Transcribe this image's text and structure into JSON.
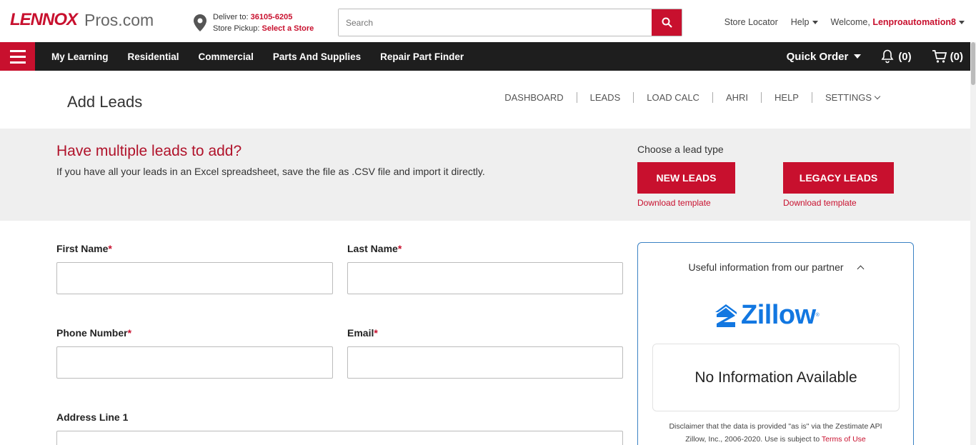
{
  "header": {
    "logo_brand": "LENNOX",
    "logo_site": "Pros.com",
    "deliver_label": "Deliver to:",
    "deliver_zip": "36105-6205",
    "pickup_label": "Store Pickup:",
    "pickup_link": "Select a Store",
    "search_placeholder": "Search",
    "store_locator": "Store Locator",
    "help": "Help",
    "welcome": "Welcome,",
    "username": "Lenproautomation8"
  },
  "nav": {
    "items": [
      "My Learning",
      "Residential",
      "Commercial",
      "Parts And Supplies",
      "Repair Part Finder"
    ],
    "quick_order": "Quick Order",
    "notifications": "(0)",
    "cart": "(0)"
  },
  "page": {
    "title": "Add Leads",
    "subnav": [
      "DASHBOARD",
      "LEADS",
      "LOAD CALC",
      "AHRI",
      "HELP",
      "SETTINGS"
    ]
  },
  "banner": {
    "heading": "Have multiple leads to add?",
    "text": "If you have all your leads in an Excel spreadsheet, save the file as .CSV file and import it directly.",
    "lead_type_label": "Choose a lead type",
    "new_leads": "NEW LEADS",
    "legacy_leads": "LEGACY LEADS",
    "download_template": "Download template"
  },
  "form": {
    "first_name": "First Name",
    "last_name": "Last Name",
    "phone": "Phone Number",
    "email": "Email",
    "address1": "Address Line 1",
    "required_mark": "*"
  },
  "partner": {
    "heading": "Useful information from our partner",
    "brand": "Zillow",
    "registered": "®",
    "no_info": "No Information Available",
    "disclaimer_line1": "Disclaimer that the data is provided \"as is\" via the Zestimate API",
    "disclaimer_line2": "Zillow, Inc., 2006-2020. Use is subject to ",
    "terms_link": "Terms of Use"
  },
  "colors": {
    "brand_red": "#c8102e",
    "nav_dark": "#1e1e1e",
    "zillow_blue": "#1277e1",
    "banner_gray": "#efefef"
  }
}
